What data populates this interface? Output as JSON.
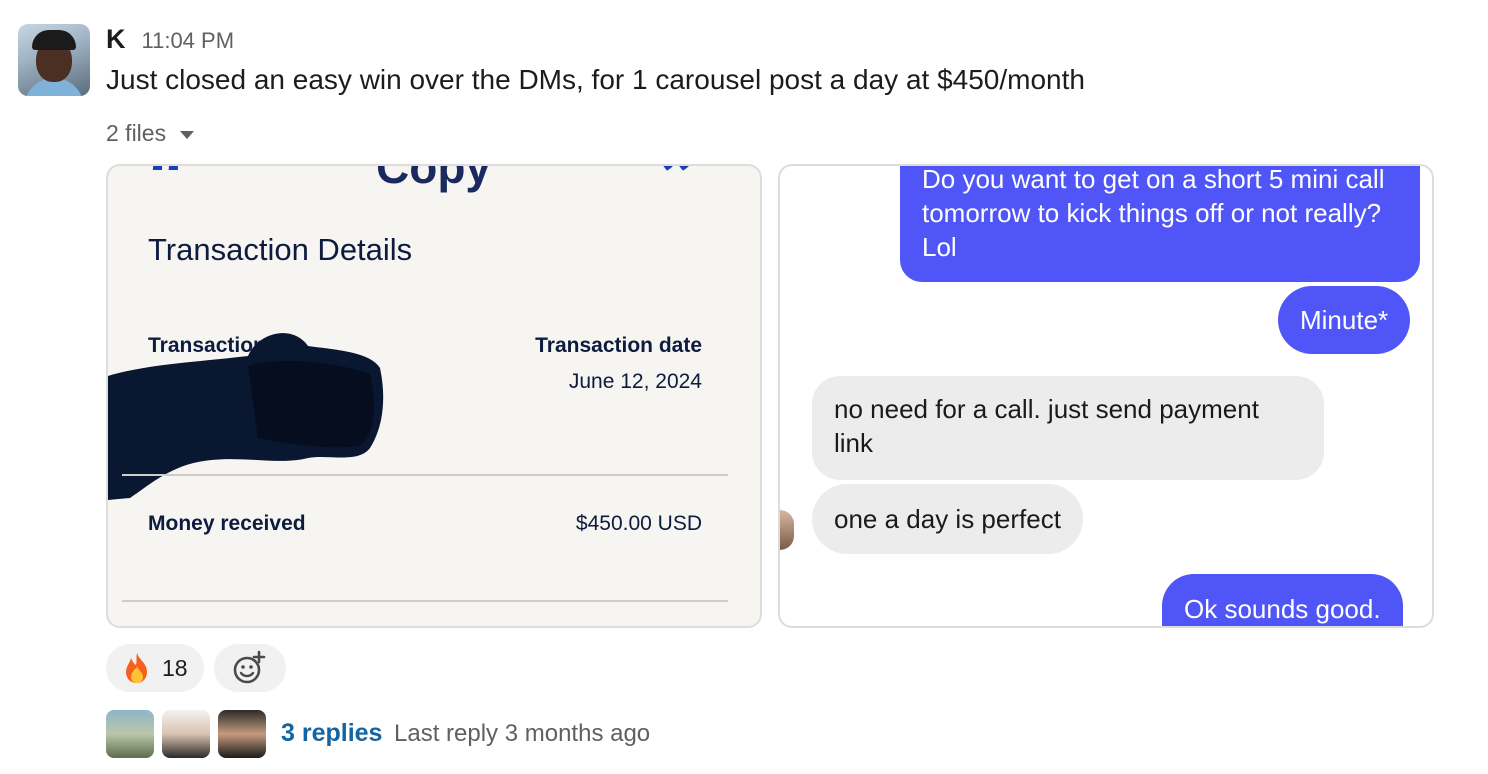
{
  "message": {
    "author": "K",
    "time": "11:04 PM",
    "text": "Just closed an easy win over the DMs, for 1 carousel post a day at $450/month"
  },
  "files": {
    "toggle_label": "2 files",
    "receipt": {
      "header_fragment": "Copy",
      "title": "Transaction Details",
      "id_label": "Transaction ID",
      "date_label": "Transaction date",
      "date_value": "June 12, 2024",
      "money_label": "Money received",
      "money_value": "$450.00 USD",
      "accent_color": "#1a3db8"
    },
    "chat": {
      "messages": [
        {
          "side": "sent",
          "text": "Do you want to get on a short 5 mini call tomorrow to kick things off or not really? Lol"
        },
        {
          "side": "sent",
          "text": "Minute*"
        },
        {
          "side": "received",
          "text": "no need for a call. just send payment link"
        },
        {
          "side": "received",
          "text": "one a day is perfect"
        },
        {
          "side": "sent",
          "text": "Ok sounds good."
        }
      ],
      "sent_color": "#4f55f7",
      "received_color": "#ececed"
    }
  },
  "reactions": [
    {
      "emoji_icon": "fire-icon",
      "count": "18"
    }
  ],
  "add_reaction_icon": "add-emoji-icon",
  "thread": {
    "replies_label": "3 replies",
    "last_reply": "Last reply 3 months ago",
    "link_color": "#1264a3"
  }
}
